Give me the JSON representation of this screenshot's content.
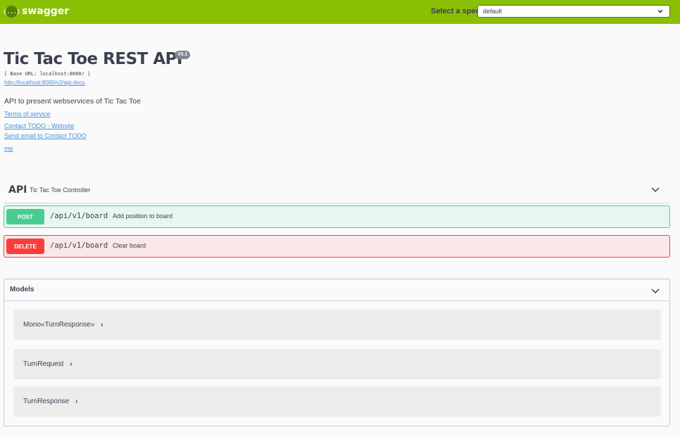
{
  "topbar": {
    "logo_glyph": "{...}",
    "brand": "swagger",
    "spec_label": "Select a spec",
    "spec_value": "default"
  },
  "info": {
    "title": "Tic Tac Toe REST API",
    "version": "V0.1",
    "base_url": "[ Base URL: localhost:8080/ ]",
    "api_docs_link": "http://localhost:8080/v2/api-docs",
    "description": "API to present webservices of Tic Tac Toe",
    "links": [
      "Terms of service",
      "Contact TODO - Website",
      "Send email to Contact TODO",
      "me"
    ]
  },
  "tag": {
    "name": "API",
    "description": "Tic Tac Toe Controller"
  },
  "operations": [
    {
      "method": "POST",
      "path": "/api/v1/board",
      "summary": "Add position to board"
    },
    {
      "method": "DELETE",
      "path": "/api/v1/board",
      "summary": "Clear board"
    }
  ],
  "models": {
    "title": "Models",
    "items": [
      {
        "name": "Mono«TurnResponse»"
      },
      {
        "name": "TurnRequest"
      },
      {
        "name": "TurnResponse"
      }
    ]
  },
  "colors": {
    "topbar": "#89bf04",
    "post": "#49cc90",
    "delete": "#f93e3e",
    "link": "#4990e2"
  },
  "icons": [
    "swagger-logo-icon",
    "chevron-down-icon",
    "chevron-right-icon"
  ]
}
